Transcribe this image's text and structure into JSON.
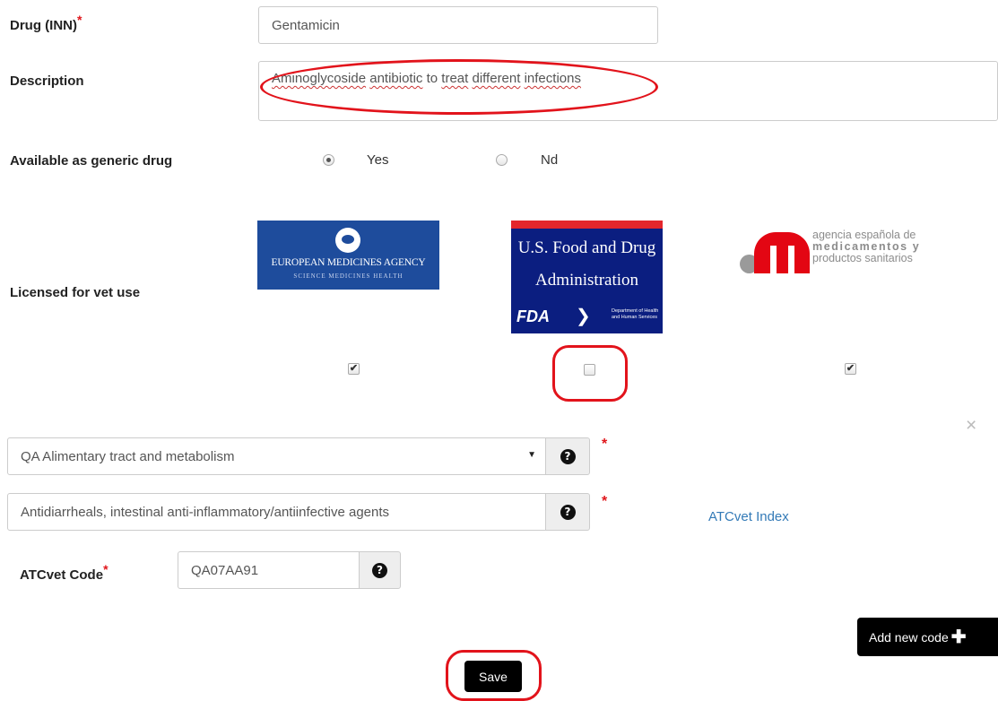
{
  "form": {
    "drug_label": "Drug (INN)",
    "drug_value": "Gentamicin",
    "description_label": "Description",
    "description_words": [
      "Aminoglycoside",
      "antibiotic",
      "to",
      "treat",
      "different",
      "infections"
    ],
    "generic_label": "Available as generic drug",
    "generic_options": [
      {
        "label": "Yes",
        "selected": true
      },
      {
        "label": "Nd",
        "selected": false
      }
    ],
    "licensed_label": "Licensed for vet use",
    "required_mark": "*"
  },
  "agencies": [
    {
      "name": "EUROPEAN MEDICINES AGENCY",
      "tagline": "SCIENCE  MEDICINES  HEALTH",
      "checked": true
    },
    {
      "name_line1": "U.S. Food and Drug",
      "name_line2": "Administration",
      "logo_text": "FDA",
      "dept_text": "Department of Health and Human Services",
      "checked": false
    },
    {
      "name_line1": "agencia española de",
      "name_line2": "medicamentos y",
      "name_line3": "productos sanitarios",
      "checked": true
    }
  ],
  "atc": {
    "group_select": "QA Alimentary tract and metabolism",
    "subgroup_value": "Antidiarrheals, intestinal anti-inflammatory/antiinfective agents",
    "index_link": "ATCvet Index",
    "code_label": "ATCvet Code",
    "code_value": "QA07AA91",
    "close_symbol": "×"
  },
  "actions": {
    "add_new_code": "Add new code",
    "save": "Save"
  },
  "colors": {
    "highlight_ring": "#e2131b",
    "required": "#e0161b",
    "link": "#337ab7",
    "ema_blue": "#1e4c9c",
    "fda_navy": "#0b1e80",
    "aemps_red": "#e30613"
  }
}
